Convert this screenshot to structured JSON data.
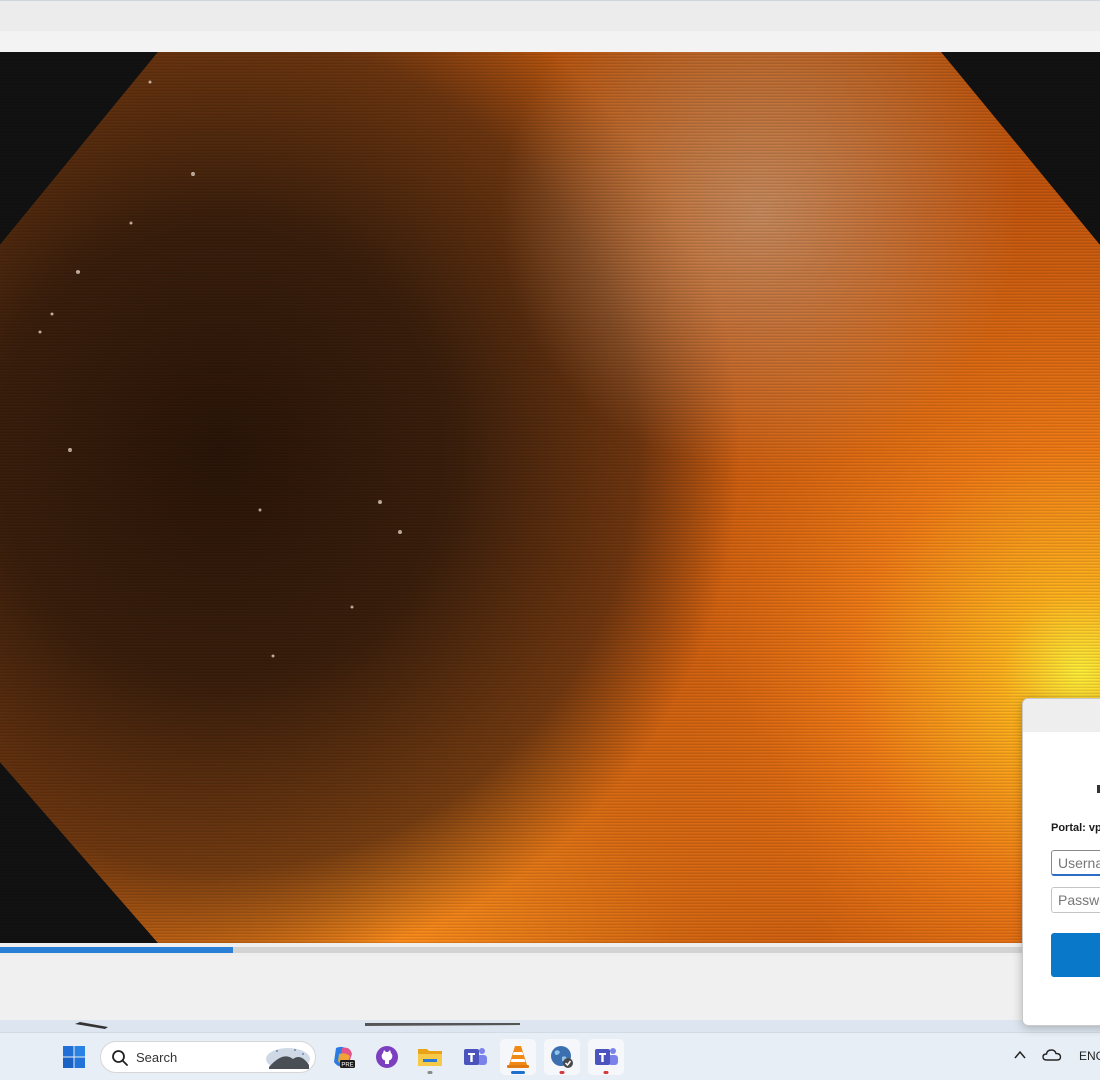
{
  "window": {
    "name": "media-player"
  },
  "video": {
    "frame": "endoscopy-frame",
    "progress": 0.212
  },
  "login_dialog": {
    "portal_label": "Portal: vp",
    "username_placeholder": "Userna",
    "password_placeholder": "Passwo",
    "connect_label": ""
  },
  "taskbar": {
    "search_label": "Search",
    "apps": [
      "windows-start-icon",
      "copilot-pre-icon",
      "github-icon",
      "file-explorer-icon",
      "teams-icon",
      "vlc-icon",
      "vpn-globe-icon",
      "teams-work-icon"
    ],
    "tray": {
      "language": "ENG"
    }
  },
  "colors": {
    "accent": "#2a7fd6",
    "connect_button": "#0a78c8",
    "taskbar": "#e8eef6"
  }
}
